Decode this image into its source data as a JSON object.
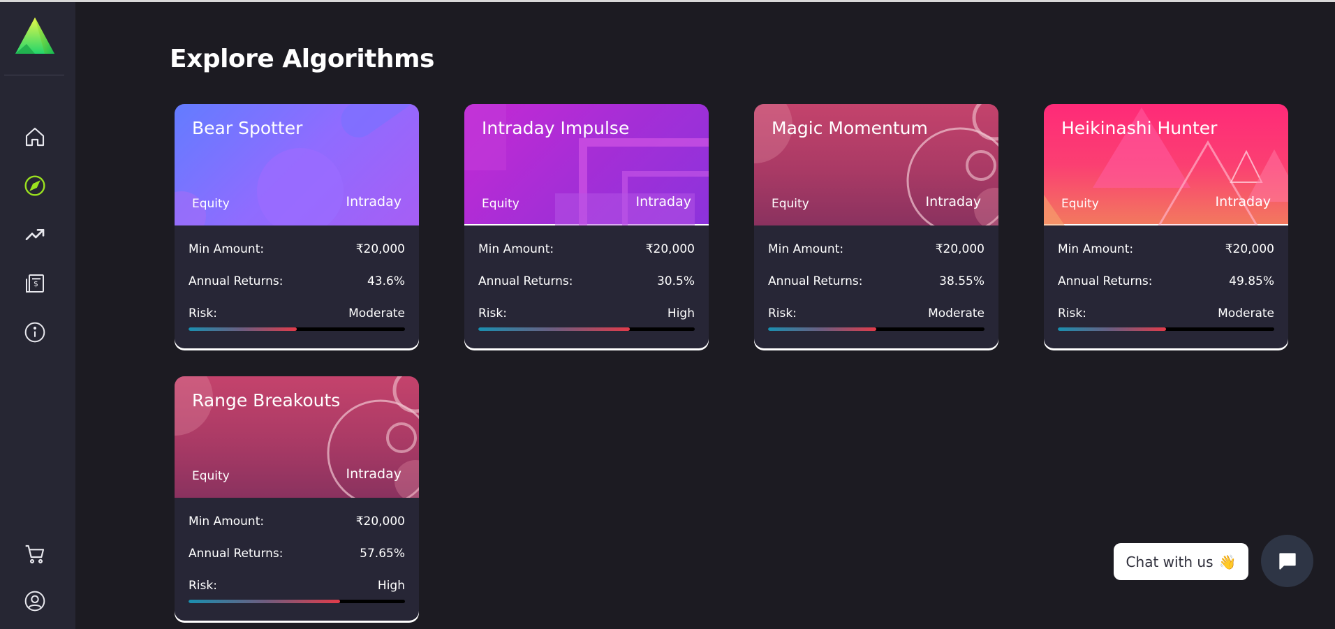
{
  "page": {
    "title": "Explore Algorithms"
  },
  "sidebar": {
    "logo_icon": "triangle-logo-icon",
    "items": [
      {
        "icon": "home-icon"
      },
      {
        "icon": "compass-icon",
        "active": true,
        "active_color": "#9be21f"
      },
      {
        "icon": "trending-up-icon"
      },
      {
        "icon": "billing-icon"
      },
      {
        "icon": "info-icon"
      },
      {
        "icon": "cart-icon"
      },
      {
        "icon": "user-profile-icon"
      }
    ]
  },
  "algorithms": [
    {
      "title": "Bear Spotter",
      "segment": "Equity",
      "type": "Intraday",
      "min_amount_label": "Min Amount:",
      "min_amount": "₹20,000",
      "returns_label": "Annual Returns:",
      "returns": "43.6%",
      "risk_label": "Risk:",
      "risk": "Moderate",
      "risk_level": 0.5,
      "colors": [
        "#6b7dff",
        "#a05cf5"
      ]
    },
    {
      "title": "Intraday Impulse",
      "segment": "Equity",
      "type": "Intraday",
      "min_amount_label": "Min Amount:",
      "min_amount": "₹20,000",
      "returns_label": "Annual Returns:",
      "returns": "30.5%",
      "risk_label": "Risk:",
      "risk": "High",
      "risk_level": 0.7,
      "colors": [
        "#b52ad0",
        "#8a2fd8"
      ]
    },
    {
      "title": "Magic Momentum",
      "segment": "Equity",
      "type": "Intraday",
      "min_amount_label": "Min Amount:",
      "min_amount": "₹20,000",
      "returns_label": "Annual Returns:",
      "returns": "38.55%",
      "risk_label": "Risk:",
      "risk": "Moderate",
      "risk_level": 0.5,
      "colors": [
        "#c0446a",
        "#8d3460"
      ]
    },
    {
      "title": "Heikinashi Hunter",
      "segment": "Equity",
      "type": "Intraday",
      "min_amount_label": "Min Amount:",
      "min_amount": "₹20,000",
      "returns_label": "Annual Returns:",
      "returns": "49.85%",
      "risk_label": "Risk:",
      "risk": "Moderate",
      "risk_level": 0.5,
      "colors": [
        "#fc2b7a",
        "#f47d5c"
      ]
    },
    {
      "title": "Range Breakouts",
      "segment": "Equity",
      "type": "Intraday",
      "min_amount_label": "Min Amount:",
      "min_amount": "₹20,000",
      "returns_label": "Annual Returns:",
      "returns": "57.65%",
      "risk_label": "Risk:",
      "risk": "High",
      "risk_level": 0.7,
      "colors": [
        "#c0446a",
        "#8d3460"
      ]
    }
  ],
  "chat": {
    "label": "Chat with us",
    "emoji": "👋",
    "icon": "chat-icon"
  }
}
